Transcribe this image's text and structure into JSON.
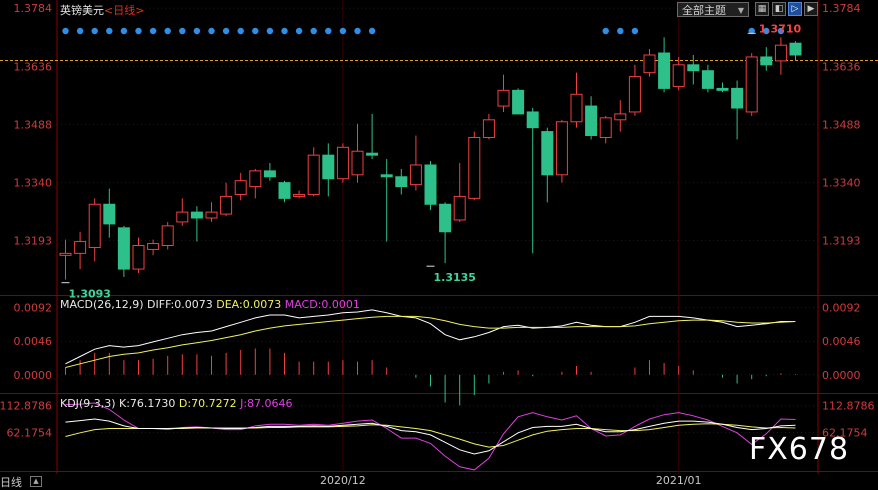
{
  "window": {
    "instrument": "英镑美元",
    "separator": "<",
    "period": "日线",
    "period_close": ">",
    "theme_button": "全部主题",
    "bottom_tab": "日线",
    "watermark": "FX678"
  },
  "colors": {
    "up": "#f04040",
    "down": "#2ec08a",
    "grid": "#8a0000",
    "axis_price": "#d23a3a",
    "diff_line": "#ffffff",
    "dea_line": "#f0f060",
    "macd_label": "#e040e0",
    "kdj_k": "#ffffff",
    "kdj_d": "#f0f060",
    "kdj_j": "#e040e0",
    "dots": "#2f8fe6"
  },
  "chart_data": [
    {
      "type": "candlestick",
      "title": "英镑美元<日线>",
      "y_axis_ticks": [
        "1.3784",
        "1.3636",
        "1.3488",
        "1.3340",
        "1.3193"
      ],
      "y_range": [
        1.3054,
        1.3805
      ],
      "x_axis_labels": [
        {
          "label": "2020/12",
          "index": 19
        },
        {
          "label": "2021/01",
          "index": 42
        }
      ],
      "last_price_line": 1.3651,
      "annotations": [
        {
          "text": "1.3093",
          "index": 0,
          "value": 1.3093,
          "kind": "low"
        },
        {
          "text": "1.3135",
          "index": 25,
          "value": 1.3135,
          "kind": "low"
        },
        {
          "text": "1.3710",
          "index": 47,
          "value": 1.371,
          "kind": "high"
        }
      ],
      "candles": [
        {
          "o": 1.3155,
          "h": 1.3195,
          "l": 1.3093,
          "c": 1.316
        },
        {
          "o": 1.316,
          "h": 1.3215,
          "l": 1.312,
          "c": 1.319
        },
        {
          "o": 1.3175,
          "h": 1.33,
          "l": 1.314,
          "c": 1.3285
        },
        {
          "o": 1.3285,
          "h": 1.3325,
          "l": 1.32,
          "c": 1.3235
        },
        {
          "o": 1.3225,
          "h": 1.323,
          "l": 1.31,
          "c": 1.312
        },
        {
          "o": 1.312,
          "h": 1.32,
          "l": 1.311,
          "c": 1.318
        },
        {
          "o": 1.317,
          "h": 1.3195,
          "l": 1.3155,
          "c": 1.3185
        },
        {
          "o": 1.318,
          "h": 1.324,
          "l": 1.317,
          "c": 1.323
        },
        {
          "o": 1.324,
          "h": 1.33,
          "l": 1.323,
          "c": 1.3265
        },
        {
          "o": 1.3265,
          "h": 1.328,
          "l": 1.319,
          "c": 1.325
        },
        {
          "o": 1.325,
          "h": 1.329,
          "l": 1.324,
          "c": 1.3265
        },
        {
          "o": 1.326,
          "h": 1.334,
          "l": 1.3255,
          "c": 1.3305
        },
        {
          "o": 1.331,
          "h": 1.3365,
          "l": 1.3295,
          "c": 1.3345
        },
        {
          "o": 1.333,
          "h": 1.3375,
          "l": 1.33,
          "c": 1.337
        },
        {
          "o": 1.337,
          "h": 1.339,
          "l": 1.3345,
          "c": 1.3355
        },
        {
          "o": 1.334,
          "h": 1.3345,
          "l": 1.329,
          "c": 1.33
        },
        {
          "o": 1.3305,
          "h": 1.332,
          "l": 1.33,
          "c": 1.331
        },
        {
          "o": 1.331,
          "h": 1.343,
          "l": 1.3305,
          "c": 1.341
        },
        {
          "o": 1.341,
          "h": 1.344,
          "l": 1.3305,
          "c": 1.335
        },
        {
          "o": 1.335,
          "h": 1.344,
          "l": 1.334,
          "c": 1.343
        },
        {
          "o": 1.336,
          "h": 1.349,
          "l": 1.334,
          "c": 1.342
        },
        {
          "o": 1.3415,
          "h": 1.3515,
          "l": 1.34,
          "c": 1.341
        },
        {
          "o": 1.336,
          "h": 1.34,
          "l": 1.319,
          "c": 1.3355
        },
        {
          "o": 1.3355,
          "h": 1.3375,
          "l": 1.331,
          "c": 1.333
        },
        {
          "o": 1.3335,
          "h": 1.346,
          "l": 1.332,
          "c": 1.3385
        },
        {
          "o": 1.3385,
          "h": 1.3395,
          "l": 1.327,
          "c": 1.3285
        },
        {
          "o": 1.3285,
          "h": 1.329,
          "l": 1.3135,
          "c": 1.3215
        },
        {
          "o": 1.3245,
          "h": 1.339,
          "l": 1.324,
          "c": 1.3305
        },
        {
          "o": 1.33,
          "h": 1.347,
          "l": 1.3295,
          "c": 1.3455
        },
        {
          "o": 1.3455,
          "h": 1.3515,
          "l": 1.345,
          "c": 1.35
        },
        {
          "o": 1.3535,
          "h": 1.3615,
          "l": 1.352,
          "c": 1.3575
        },
        {
          "o": 1.3575,
          "h": 1.358,
          "l": 1.3525,
          "c": 1.3515
        },
        {
          "o": 1.352,
          "h": 1.353,
          "l": 1.316,
          "c": 1.348
        },
        {
          "o": 1.347,
          "h": 1.348,
          "l": 1.329,
          "c": 1.336
        },
        {
          "o": 1.336,
          "h": 1.35,
          "l": 1.334,
          "c": 1.3495
        },
        {
          "o": 1.3495,
          "h": 1.362,
          "l": 1.348,
          "c": 1.3565
        },
        {
          "o": 1.3535,
          "h": 1.356,
          "l": 1.345,
          "c": 1.346
        },
        {
          "o": 1.3455,
          "h": 1.351,
          "l": 1.344,
          "c": 1.3505
        },
        {
          "o": 1.35,
          "h": 1.355,
          "l": 1.347,
          "c": 1.3515
        },
        {
          "o": 1.352,
          "h": 1.364,
          "l": 1.351,
          "c": 1.361
        },
        {
          "o": 1.362,
          "h": 1.368,
          "l": 1.361,
          "c": 1.3665
        },
        {
          "o": 1.367,
          "h": 1.371,
          "l": 1.357,
          "c": 1.358
        },
        {
          "o": 1.3585,
          "h": 1.366,
          "l": 1.3575,
          "c": 1.364
        },
        {
          "o": 1.364,
          "h": 1.3665,
          "l": 1.359,
          "c": 1.3625
        },
        {
          "o": 1.3625,
          "h": 1.364,
          "l": 1.357,
          "c": 1.358
        },
        {
          "o": 1.358,
          "h": 1.3595,
          "l": 1.357,
          "c": 1.3575
        },
        {
          "o": 1.358,
          "h": 1.36,
          "l": 1.345,
          "c": 1.353
        },
        {
          "o": 1.352,
          "h": 1.367,
          "l": 1.351,
          "c": 1.366
        },
        {
          "o": 1.366,
          "h": 1.3685,
          "l": 1.3625,
          "c": 1.364
        },
        {
          "o": 1.365,
          "h": 1.371,
          "l": 1.3615,
          "c": 1.369
        },
        {
          "o": 1.3695,
          "h": 1.37,
          "l": 1.365,
          "c": 1.3665
        }
      ]
    },
    {
      "type": "line",
      "title": "MACD(26,12,9)",
      "legend": [
        {
          "label": "DIFF:0.0073",
          "series": "DIFF"
        },
        {
          "label": "DEA:0.0073",
          "series": "DEA"
        },
        {
          "label": "MACD:0.0001",
          "series": "MACD"
        }
      ],
      "y_axis_ticks": [
        "0.0092",
        "0.0046",
        "0.0000"
      ],
      "y_range": [
        -0.0025,
        0.0108
      ],
      "series": [
        {
          "name": "DIFF",
          "values": [
            0.0015,
            0.0025,
            0.0035,
            0.004,
            0.0038,
            0.004,
            0.0045,
            0.005,
            0.0055,
            0.0058,
            0.006,
            0.0066,
            0.0072,
            0.0078,
            0.0082,
            0.0082,
            0.0078,
            0.008,
            0.0082,
            0.0085,
            0.0086,
            0.0089,
            0.0085,
            0.008,
            0.0078,
            0.007,
            0.0055,
            0.0048,
            0.0052,
            0.0058,
            0.0066,
            0.0068,
            0.0064,
            0.0065,
            0.0067,
            0.0072,
            0.0068,
            0.0066,
            0.0066,
            0.0072,
            0.008,
            0.008,
            0.008,
            0.0078,
            0.0075,
            0.0072,
            0.0066,
            0.0068,
            0.007,
            0.0073,
            0.0073
          ]
        },
        {
          "name": "DEA",
          "values": [
            0.001,
            0.0015,
            0.002,
            0.0025,
            0.0028,
            0.003,
            0.0034,
            0.0037,
            0.0041,
            0.0044,
            0.0047,
            0.0051,
            0.0055,
            0.006,
            0.0064,
            0.0067,
            0.0069,
            0.0071,
            0.0073,
            0.0075,
            0.0077,
            0.0079,
            0.008,
            0.008,
            0.008,
            0.0078,
            0.0074,
            0.0069,
            0.0066,
            0.0064,
            0.0064,
            0.0065,
            0.0065,
            0.0065,
            0.0065,
            0.0066,
            0.0066,
            0.0066,
            0.0066,
            0.0067,
            0.007,
            0.0072,
            0.0074,
            0.0075,
            0.0075,
            0.0074,
            0.0072,
            0.0071,
            0.0071,
            0.0072,
            0.0073
          ]
        },
        {
          "name": "MACD",
          "values": [
            0.001,
            0.002,
            0.003,
            0.003,
            0.002,
            0.002,
            0.0022,
            0.0026,
            0.0028,
            0.0028,
            0.0026,
            0.003,
            0.0034,
            0.0036,
            0.0036,
            0.003,
            0.0018,
            0.0018,
            0.0018,
            0.002,
            0.0018,
            0.002,
            0.001,
            0.0,
            -0.0004,
            -0.0016,
            -0.0038,
            -0.0042,
            -0.0028,
            -0.0012,
            0.0004,
            0.0006,
            -0.0002,
            0.0,
            0.0004,
            0.0012,
            0.0004,
            0.0,
            0.0,
            0.001,
            0.002,
            0.0016,
            0.0012,
            0.0006,
            0.0,
            -0.0004,
            -0.0012,
            -0.0006,
            -0.0002,
            0.0002,
            0.0001
          ]
        }
      ]
    },
    {
      "type": "line",
      "title": "KDJ(9,3,3)",
      "legend": [
        {
          "label": "K:76.1730",
          "series": "K"
        },
        {
          "label": "D:70.7272",
          "series": "D"
        },
        {
          "label": "J:87.0646",
          "series": "J"
        }
      ],
      "y_axis_ticks": [
        "112.8786",
        "62.1754"
      ],
      "y_range": [
        -10,
        135
      ],
      "series": [
        {
          "name": "K",
          "values": [
            82,
            85,
            88,
            84,
            75,
            70,
            70,
            70,
            71,
            72,
            71,
            70,
            70,
            72,
            74,
            74,
            74,
            75,
            74,
            76,
            78,
            80,
            74,
            66,
            64,
            58,
            44,
            30,
            22,
            28,
            45,
            62,
            72,
            74,
            74,
            78,
            70,
            64,
            64,
            68,
            74,
            80,
            84,
            84,
            82,
            78,
            72,
            68,
            70,
            75,
            76
          ]
        },
        {
          "name": "D",
          "values": [
            55,
            62,
            68,
            70,
            70,
            70,
            70,
            70,
            70,
            71,
            71,
            71,
            71,
            71,
            72,
            72,
            73,
            73,
            73,
            74,
            75,
            77,
            76,
            73,
            70,
            66,
            58,
            50,
            41,
            35,
            38,
            48,
            58,
            65,
            68,
            70,
            70,
            68,
            66,
            66,
            68,
            72,
            76,
            78,
            79,
            78,
            76,
            73,
            71,
            72,
            71
          ]
        },
        {
          "name": "J",
          "values": [
            115,
            116,
            118,
            106,
            86,
            70,
            70,
            68,
            72,
            73,
            71,
            68,
            68,
            75,
            78,
            78,
            76,
            78,
            76,
            80,
            84,
            86,
            70,
            52,
            52,
            42,
            18,
            -2,
            -8,
            14,
            60,
            92,
            100,
            92,
            86,
            94,
            70,
            56,
            58,
            74,
            88,
            96,
            100,
            94,
            86,
            74,
            62,
            40,
            60,
            88,
            87
          ]
        }
      ]
    }
  ]
}
